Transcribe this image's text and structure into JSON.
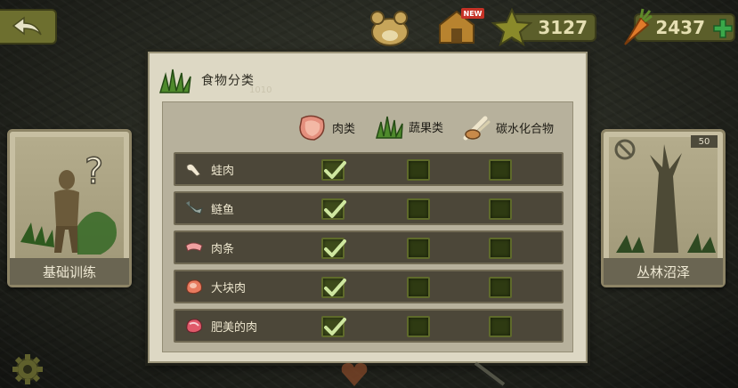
{
  "top_bar": {
    "stars": "3127",
    "carrots": "2437",
    "new_badge": "NEW"
  },
  "left_card": {
    "label": "基础训练"
  },
  "right_card": {
    "label": "丛林沼泽",
    "level": "50"
  },
  "panel": {
    "title": "食物分类",
    "faded_number": "1010",
    "columns": [
      "肉类",
      "蔬果类",
      "碳水化合物"
    ],
    "rows": [
      {
        "name": "蛙肉",
        "checks": [
          true,
          false,
          false
        ]
      },
      {
        "name": "鲢鱼",
        "checks": [
          true,
          false,
          false
        ]
      },
      {
        "name": "肉条",
        "checks": [
          true,
          false,
          false
        ]
      },
      {
        "name": "大块肉",
        "checks": [
          true,
          false,
          false
        ]
      },
      {
        "name": "肥美的肉",
        "checks": [
          true,
          false,
          false
        ]
      }
    ]
  },
  "colors": {
    "panel_bg": "#ddd8c4",
    "row_bg": "#4c4739",
    "check_green": "#cfe7a0",
    "cell_dark": "#2e3a12"
  },
  "icons": [
    "back-arrow-icon",
    "bear-icon",
    "house-icon",
    "star-icon",
    "carrot-icon",
    "plus-icon",
    "grass-icon",
    "meat-icon",
    "bone-icon",
    "frog-leg-icon",
    "fish-icon",
    "meat-strip-icon",
    "gear-icon"
  ]
}
